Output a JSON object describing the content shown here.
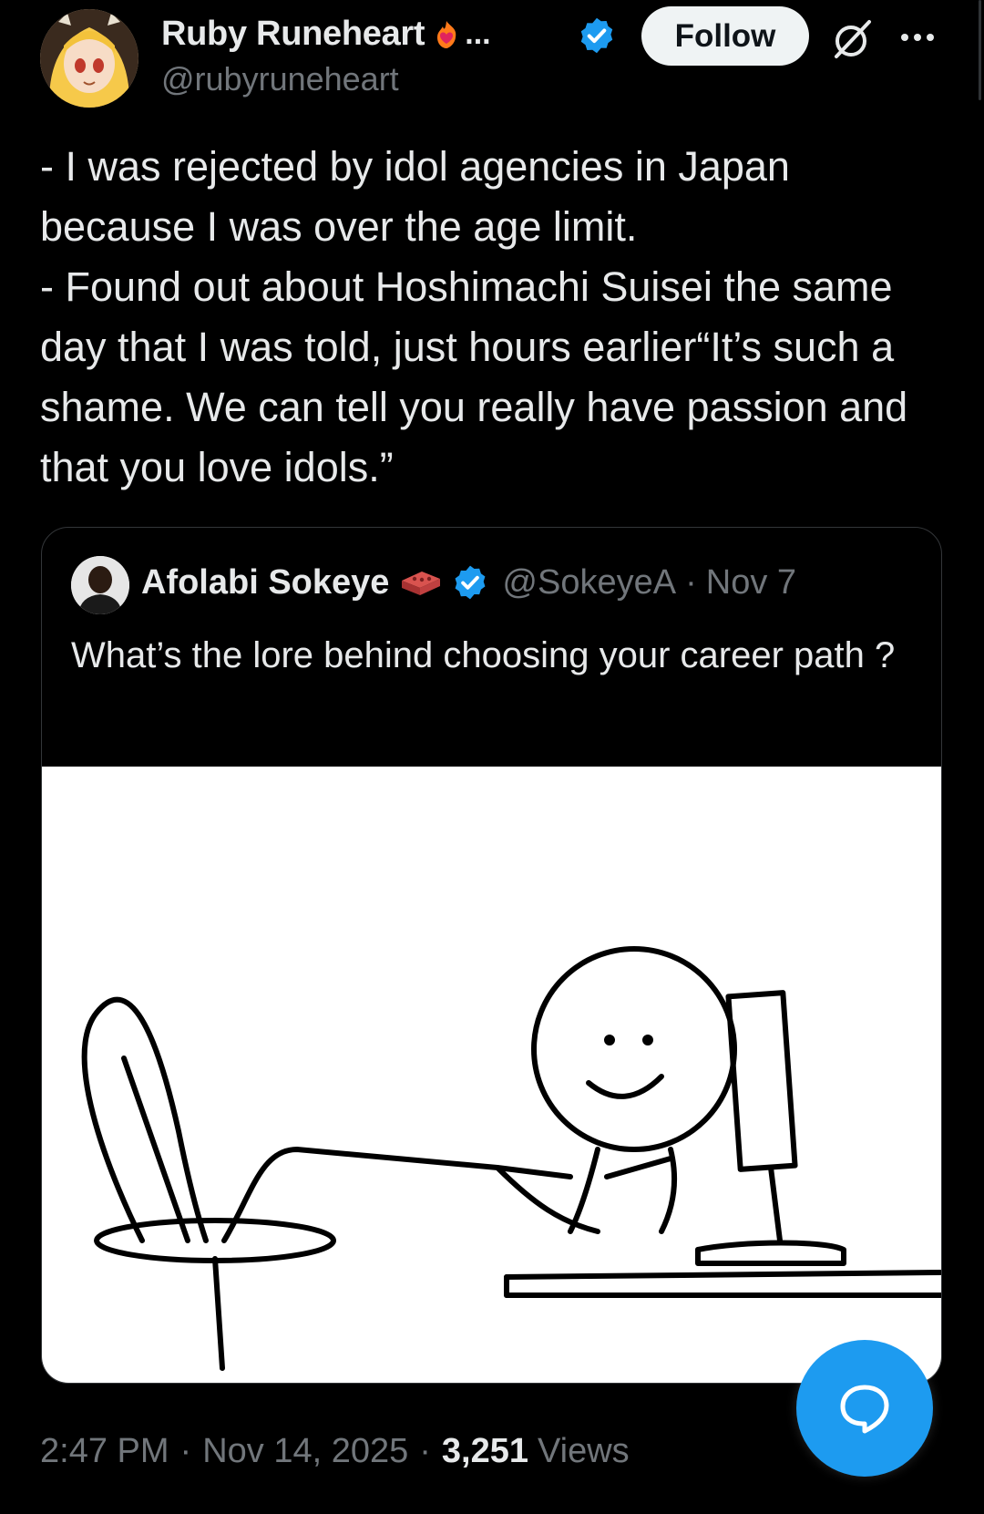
{
  "author": {
    "display_name": "Ruby Runeheart",
    "name_truncation": "...",
    "handle": "@rubyruneheart",
    "verified": true,
    "avatar_icon": "anime-avatar-icon"
  },
  "actions": {
    "follow_label": "Follow",
    "grok_icon": "grok-icon",
    "more_icon": "more-icon"
  },
  "tweet": {
    "lines": [
      "- I was rejected by idol agencies in Japan because I was over the age limit.",
      "- Found out about Hoshimachi Suisei the same day that I was told, just hours earlier“It’s such a shame. We can tell you really have passion and that you love idols.”"
    ]
  },
  "quoted_tweet": {
    "display_name": "Afolabi Sokeye",
    "handle": "@SokeyeA",
    "separator": "·",
    "date": "Nov 7",
    "text": "What’s the lore behind choosing your career path ?",
    "image_icon": "stick-figure-computer-drawing"
  },
  "meta": {
    "time": "2:47 PM",
    "separator": "·",
    "date": "Nov 14, 2025",
    "views_count": "3,251",
    "views_label": "Views"
  },
  "colors": {
    "background": "#000000",
    "text_primary": "#e7e9ea",
    "text_secondary": "#71767b",
    "accent": "#1d9bf0",
    "follow_bg": "#eff3f4"
  },
  "fab": {
    "icon": "reply-bubble-icon"
  }
}
